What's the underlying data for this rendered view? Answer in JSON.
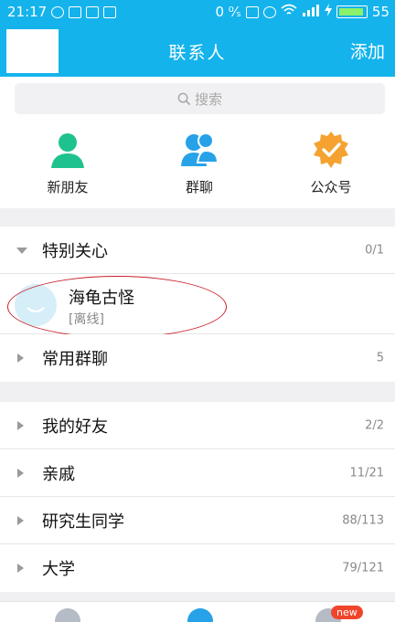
{
  "status_bar": {
    "time": "21:17",
    "net_speed": "0 ⁰⁄ₛ",
    "battery": "55"
  },
  "header": {
    "title": "联系人",
    "add_label": "添加"
  },
  "search": {
    "placeholder": "搜索"
  },
  "quick_actions": [
    {
      "label": "新朋友",
      "icon": "person-icon",
      "color": "#1fc28e"
    },
    {
      "label": "群聊",
      "icon": "group-chat-icon",
      "color": "#27a2e8"
    },
    {
      "label": "公众号",
      "icon": "public-account-icon",
      "color": "#f5a230"
    }
  ],
  "groups": [
    {
      "name": "特别关心",
      "count": "0/1",
      "expanded": true
    },
    {
      "name": "常用群聊",
      "count": "5",
      "expanded": false
    },
    {
      "name": "我的好友",
      "count": "2/2",
      "expanded": false
    },
    {
      "name": "亲戚",
      "count": "11/21",
      "expanded": false
    },
    {
      "name": "研究生同学",
      "count": "88/113",
      "expanded": false
    },
    {
      "name": "大学",
      "count": "79/121",
      "expanded": false
    }
  ],
  "special_contact": {
    "name": "海龟古怪",
    "status": "[离线]"
  },
  "bottom_bar": {
    "badge": "new"
  },
  "colors": {
    "accent": "#14b3ec",
    "annotation": "#c8202a"
  }
}
